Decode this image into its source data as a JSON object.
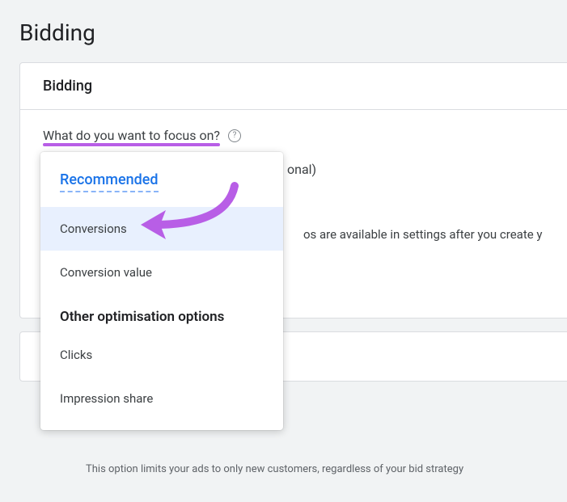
{
  "page": {
    "title": "Bidding"
  },
  "card": {
    "header": "Bidding",
    "question": "What do you want to focus on?",
    "hidden_text_1": "onal)",
    "hidden_text_2": "os are available in settings after you create y"
  },
  "dropdown": {
    "recommended_label": "Recommended",
    "other_label": "Other optimisation options",
    "options": {
      "conversions": "Conversions",
      "conversion_value": "Conversion value",
      "clicks": "Clicks",
      "impression_share": "Impression share"
    }
  },
  "footnote": "This option limits your ads to only new customers, regardless of your bid strategy",
  "icons": {
    "help": "?"
  }
}
